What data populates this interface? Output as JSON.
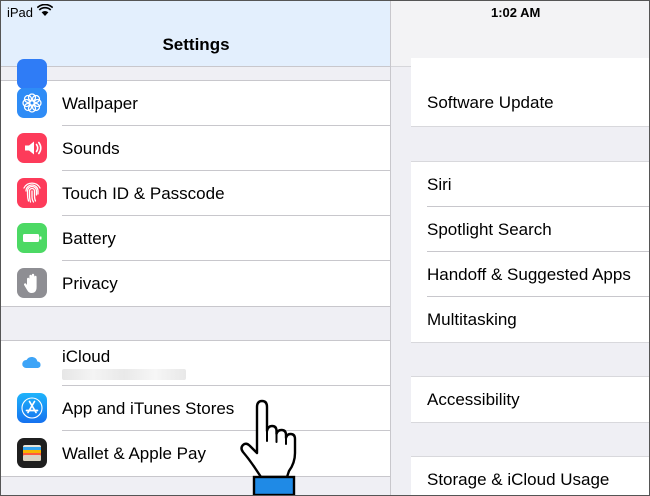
{
  "status_bar": {
    "device": "iPad",
    "time": "1:02 AM"
  },
  "sidebar": {
    "title": "Settings",
    "groups": [
      {
        "items": [
          {
            "label": "Wallpaper",
            "icon": "wallpaper-icon",
            "color": "#2f8cf6"
          },
          {
            "label": "Sounds",
            "icon": "sounds-icon",
            "color": "#fd3b5a"
          },
          {
            "label": "Touch ID & Passcode",
            "icon": "fingerprint-icon",
            "color": "#fd3b5a"
          },
          {
            "label": "Battery",
            "icon": "battery-icon",
            "color": "#4cd964"
          },
          {
            "label": "Privacy",
            "icon": "privacy-hand-icon",
            "color": "#8e8e93"
          }
        ]
      },
      {
        "items": [
          {
            "label": "iCloud",
            "icon": "icloud-icon",
            "color": "#ffffff"
          },
          {
            "label": "App and iTunes Stores",
            "icon": "app-store-icon",
            "color": "#1b8bf5"
          },
          {
            "label": "Wallet & Apple Pay",
            "icon": "wallet-icon",
            "color": "#1f1f1f"
          }
        ]
      }
    ]
  },
  "detail": {
    "groups": [
      {
        "items": [
          "Software Update"
        ]
      },
      {
        "items": [
          "Siri",
          "Spotlight Search",
          "Handoff & Suggested Apps",
          "Multitasking"
        ]
      },
      {
        "items": [
          "Accessibility"
        ]
      },
      {
        "items": [
          "Storage & iCloud Usage"
        ]
      }
    ]
  }
}
